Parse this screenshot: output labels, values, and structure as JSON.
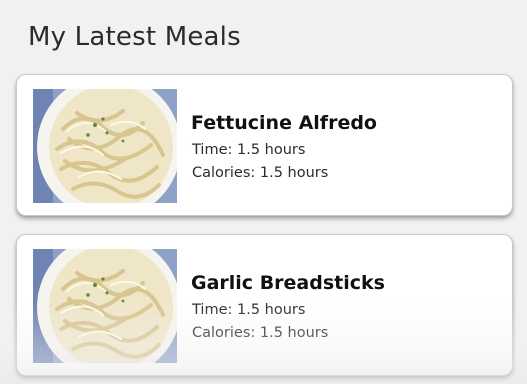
{
  "page": {
    "title": "My Latest Meals"
  },
  "meals": [
    {
      "name": "Fettucine Alfredo",
      "time": "Time: 1.5 hours",
      "calories": "Calories: 1.5 hours",
      "image_icon": "pasta-photo-icon"
    },
    {
      "name": "Garlic Breadsticks",
      "time": "Time: 1.5 hours",
      "calories": "Calories: 1.5 hours",
      "image_icon": "pasta-photo-icon"
    }
  ],
  "colors": {
    "background": "#f1f1f3",
    "card": "#ffffff",
    "text": "#2b2b2b",
    "plate_border": "#7b8fb8"
  }
}
